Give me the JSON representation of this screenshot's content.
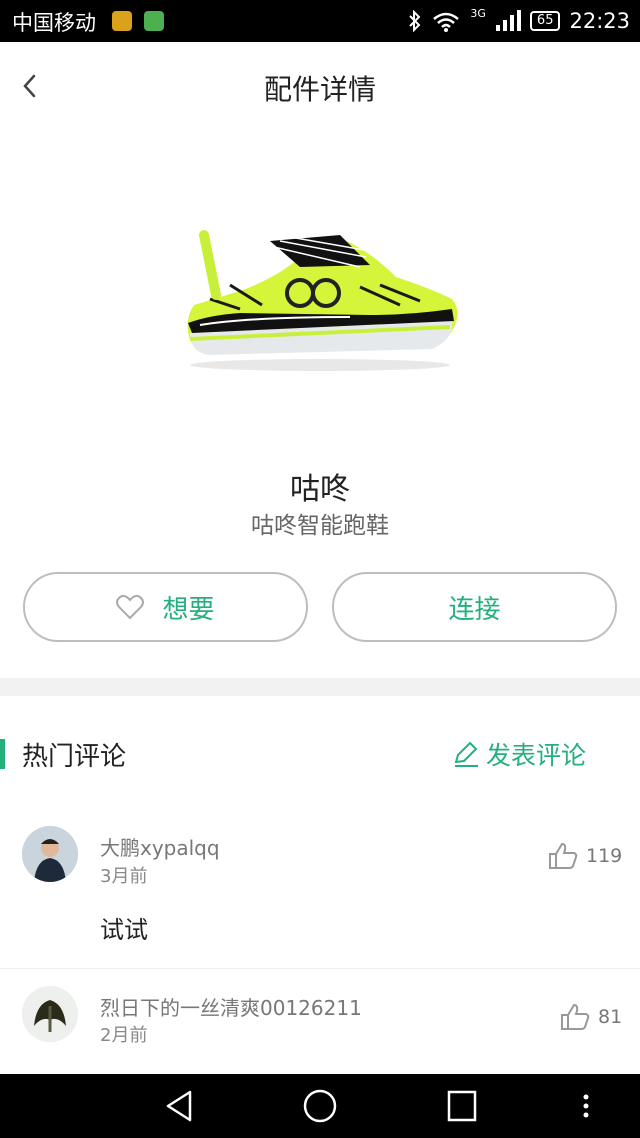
{
  "status_bar": {
    "carrier": "中国移动",
    "network": "3G",
    "battery": "65",
    "time": "22:23"
  },
  "header": {
    "title": "配件详情",
    "back_icon": "chevron-left-icon"
  },
  "product": {
    "name": "咕咚",
    "description": "咕咚智能跑鞋",
    "image": "running-shoe-image",
    "accent_color": "#23b07c"
  },
  "actions": {
    "want_label": "想要",
    "want_icon": "heart-icon",
    "connect_label": "连接"
  },
  "comments_section": {
    "title": "热门评论",
    "post_label": "发表评论",
    "post_icon": "pencil-icon"
  },
  "comments": [
    {
      "user": "大鹏xypalqq",
      "time": "3月前",
      "text": "试试",
      "likes": "119"
    },
    {
      "user": "烈日下的一丝清爽00126211",
      "time": "2月前",
      "likes": "81"
    }
  ]
}
